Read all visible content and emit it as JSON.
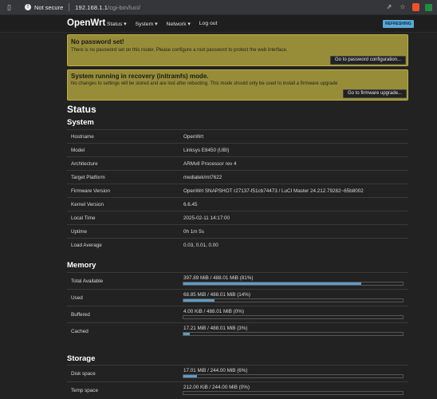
{
  "browser": {
    "security_label": "Not secure",
    "url_host": "192.168.1.1",
    "url_path": "/cgi-bin/luci/"
  },
  "header": {
    "brand": "OpenWrt",
    "menu": [
      "Status ▾",
      "System ▾",
      "Network ▾",
      "Log out"
    ],
    "indicator": "REFRESHING"
  },
  "alerts": [
    {
      "title": "No password set!",
      "text": "There is no password set on this router. Please configure a root password to protect the web interface.",
      "button": "Go to password configuration..."
    },
    {
      "title": "System running in recovery (initramfs) mode.",
      "text": "No changes to settings will be stored and are lost after rebooting. This mode should only be used to install a firmware upgrade",
      "button": "Go to firmware upgrade..."
    }
  ],
  "page_title": "Status",
  "system": {
    "heading": "System",
    "rows": [
      {
        "key": "Hostname",
        "value": "OpenWrt"
      },
      {
        "key": "Model",
        "value": "Linksys E8450 (UBI)"
      },
      {
        "key": "Architecture",
        "value": "ARMv8 Processor rev 4"
      },
      {
        "key": "Target Platform",
        "value": "mediatek/mt7622"
      },
      {
        "key": "Firmware Version",
        "value": "OpenWrt SNAPSHOT r27137-f51cb74473 / LuCI Master 24.212.79282~65b8002"
      },
      {
        "key": "Kernel Version",
        "value": "6.6.45"
      },
      {
        "key": "Local Time",
        "value": "2025-02-11 14:17:00"
      },
      {
        "key": "Uptime",
        "value": "0h 1m 5s"
      },
      {
        "key": "Load Average",
        "value": "0.03, 0.01, 0.00"
      }
    ]
  },
  "memory": {
    "heading": "Memory",
    "rows": [
      {
        "key": "Total Available",
        "value": "397.89 MiB / 488.01 MiB (81%)",
        "percent": 81
      },
      {
        "key": "Used",
        "value": "68.85 MiB / 488.01 MiB (14%)",
        "percent": 14
      },
      {
        "key": "Buffered",
        "value": "4.00 KiB / 488.01 MiB (0%)",
        "percent": 0
      },
      {
        "key": "Cached",
        "value": "17.21 MiB / 488.01 MiB (3%)",
        "percent": 3
      }
    ]
  },
  "storage": {
    "heading": "Storage",
    "rows": [
      {
        "key": "Disk space",
        "value": "17.01 MiB / 244.00 MiB (6%)",
        "percent": 6
      },
      {
        "key": "Temp space",
        "value": "212.00 KiB / 244.00 MiB (0%)",
        "percent": 0
      }
    ]
  },
  "colors": {
    "accent_bar": "#5b9cc9",
    "alert_bg": "#978d38",
    "page_bg": "#222222"
  }
}
